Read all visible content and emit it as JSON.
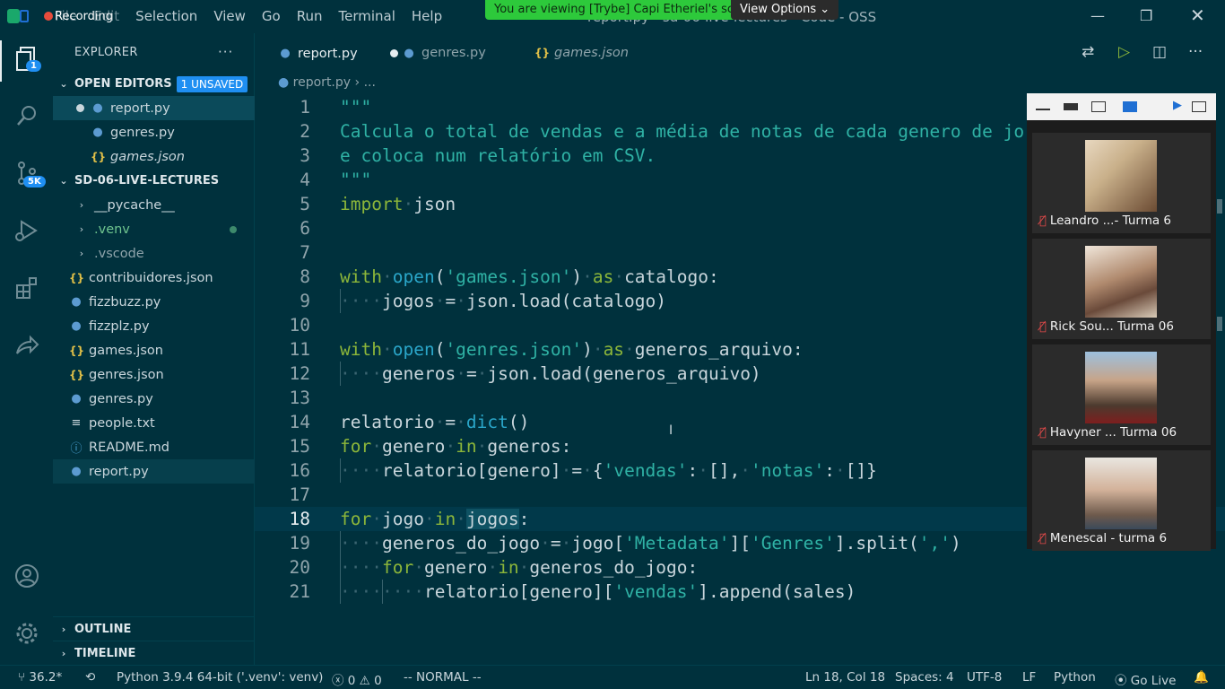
{
  "window": {
    "recording_label": "Recording",
    "title": "report.py - sd-06-live-lectures - Code - OSS",
    "share_banner": "You are viewing [Trybe] Capi Etheriel's screen",
    "view_options": "View Options",
    "controls": [
      "minimize-icon",
      "restore-icon",
      "close-icon"
    ]
  },
  "menu": [
    "File",
    "Edit",
    "Selection",
    "View",
    "Go",
    "Run",
    "Terminal",
    "Help"
  ],
  "activity_bar": {
    "items": [
      {
        "name": "explorer",
        "icon": "files-icon",
        "badge": "1"
      },
      {
        "name": "search",
        "icon": "search-icon"
      },
      {
        "name": "source-control",
        "icon": "source-control-icon",
        "badge": "5K"
      },
      {
        "name": "run-debug",
        "icon": "run-debug-icon"
      },
      {
        "name": "extensions",
        "icon": "extensions-icon"
      },
      {
        "name": "live-share",
        "icon": "live-share-icon"
      }
    ],
    "bottom": [
      {
        "name": "accounts",
        "icon": "account-icon"
      },
      {
        "name": "manage",
        "icon": "gear-icon"
      }
    ]
  },
  "sidebar": {
    "title": "EXPLORER",
    "open_editors": {
      "label": "OPEN EDITORS",
      "badge": "1 UNSAVED",
      "items": [
        {
          "name": "report.py",
          "type": "py",
          "dirty": true
        },
        {
          "name": "genres.py",
          "type": "py"
        },
        {
          "name": "games.json",
          "type": "json"
        }
      ]
    },
    "folder": {
      "label": "SD-06-LIVE-LECTURES",
      "items": [
        {
          "name": "__pycache__",
          "type": "folder"
        },
        {
          "name": ".venv",
          "type": "folder"
        },
        {
          "name": ".vscode",
          "type": "folder"
        },
        {
          "name": "contribuidores.json",
          "type": "json"
        },
        {
          "name": "fizzbuzz.py",
          "type": "py"
        },
        {
          "name": "fizzplz.py",
          "type": "py"
        },
        {
          "name": "games.json",
          "type": "json"
        },
        {
          "name": "genres.json",
          "type": "json"
        },
        {
          "name": "genres.py",
          "type": "py"
        },
        {
          "name": "people.txt",
          "type": "txt"
        },
        {
          "name": "README.md",
          "type": "md"
        },
        {
          "name": "report.py",
          "type": "py"
        }
      ]
    },
    "outline": "OUTLINE",
    "timeline": "TIMELINE"
  },
  "tabs": [
    {
      "label": "report.py",
      "active": true,
      "dirty": true
    },
    {
      "label": "genres.py"
    },
    {
      "label": "games.json"
    }
  ],
  "breadcrumb": {
    "file": "report.py",
    "rest": "..."
  },
  "code_lines": [
    "\"\"\"",
    "Calcula o total de vendas e a média de notas de cada genero de jo",
    "e coloca num relatório em CSV.",
    "\"\"\"",
    "import json",
    "",
    "",
    "with open('games.json') as catalogo:",
    "    jogos = json.load(catalogo)",
    "",
    "with open('genres.json') as generos_arquivo:",
    "    generos = json.load(generos_arquivo)",
    "",
    "relatorio = dict()",
    "for genero in generos:",
    "    relatorio[genero] = {'vendas': [], 'notas': []}",
    "",
    "for jogo in jogos:",
    "    generos_do_jogo = jogo['Metadata']['Genres'].split(',')",
    "    for genero in generos_do_jogo:",
    "        relatorio[genero]['vendas'].append(sales)"
  ],
  "participants": [
    {
      "name": "Leandro ...- Turma 6"
    },
    {
      "name": "Rick Sou... Turma 06"
    },
    {
      "name": "Havyner ... Turma 06"
    },
    {
      "name": "Menescal - turma 6"
    }
  ],
  "status": {
    "branch": "36.2*",
    "interpreter": "Python 3.9.4 64-bit ('.venv': venv)",
    "errors": "0",
    "warnings": "0",
    "vim_mode": "-- NORMAL --",
    "position": "Ln 18, Col 18",
    "spaces": "Spaces: 4",
    "encoding": "UTF-8",
    "eol": "LF",
    "language": "Python",
    "go_live": "Go Live"
  }
}
